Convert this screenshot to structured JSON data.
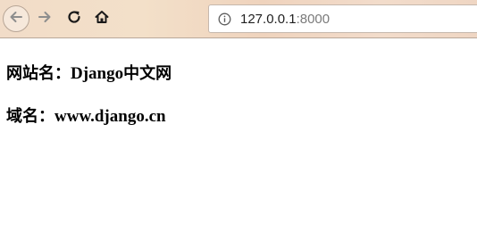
{
  "browser": {
    "url_host": "127.0.0.1",
    "url_port": ":8000",
    "icons": {
      "back": "back-arrow-icon",
      "forward": "forward-arrow-icon",
      "reload": "reload-icon",
      "home": "home-icon",
      "info": "info-icon"
    }
  },
  "page": {
    "site_name_label": "网站名：",
    "site_name_value_latin": "Django",
    "site_name_value_cjk": "中文网",
    "domain_label": "域名：",
    "domain_value": "www.django.cn"
  }
}
